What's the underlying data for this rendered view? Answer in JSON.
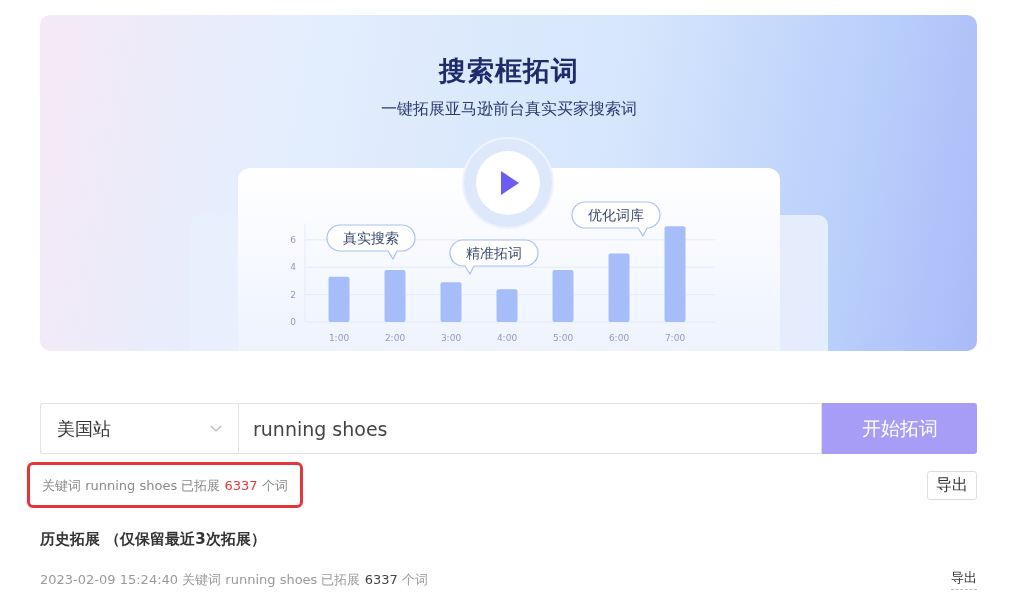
{
  "banner": {
    "title": "搜索框拓词",
    "subtitle": "一键拓展亚马逊前台真实买家搜索词",
    "callouts": [
      "真实搜索",
      "精准拓词",
      "优化词库"
    ],
    "chart_data": {
      "type": "bar",
      "categories": [
        "1:00",
        "2:00",
        "3:00",
        "4:00",
        "5:00",
        "6:00",
        "7:00"
      ],
      "values": [
        3.3,
        3.8,
        2.9,
        2.4,
        3.8,
        5.0,
        7.0
      ],
      "ylim": [
        0,
        7.2
      ],
      "yticks": [
        0,
        2,
        4,
        6
      ],
      "grid": true
    }
  },
  "search": {
    "site": "美国站",
    "value": "running shoes",
    "button": "开始拓词"
  },
  "summary": {
    "prefix": "关键词 running shoes 已拓展",
    "count": "6337",
    "suffix": "个词",
    "highlighted": true
  },
  "export_button": "导出",
  "history": {
    "heading": "历史拓展 （仅保留最近3次拓展）",
    "rows": [
      {
        "time": "2023-02-09 15:24:40",
        "prefix": "关键词 running shoes 已拓展",
        "count": "6337",
        "suffix": "个词",
        "action": "导出"
      }
    ]
  }
}
